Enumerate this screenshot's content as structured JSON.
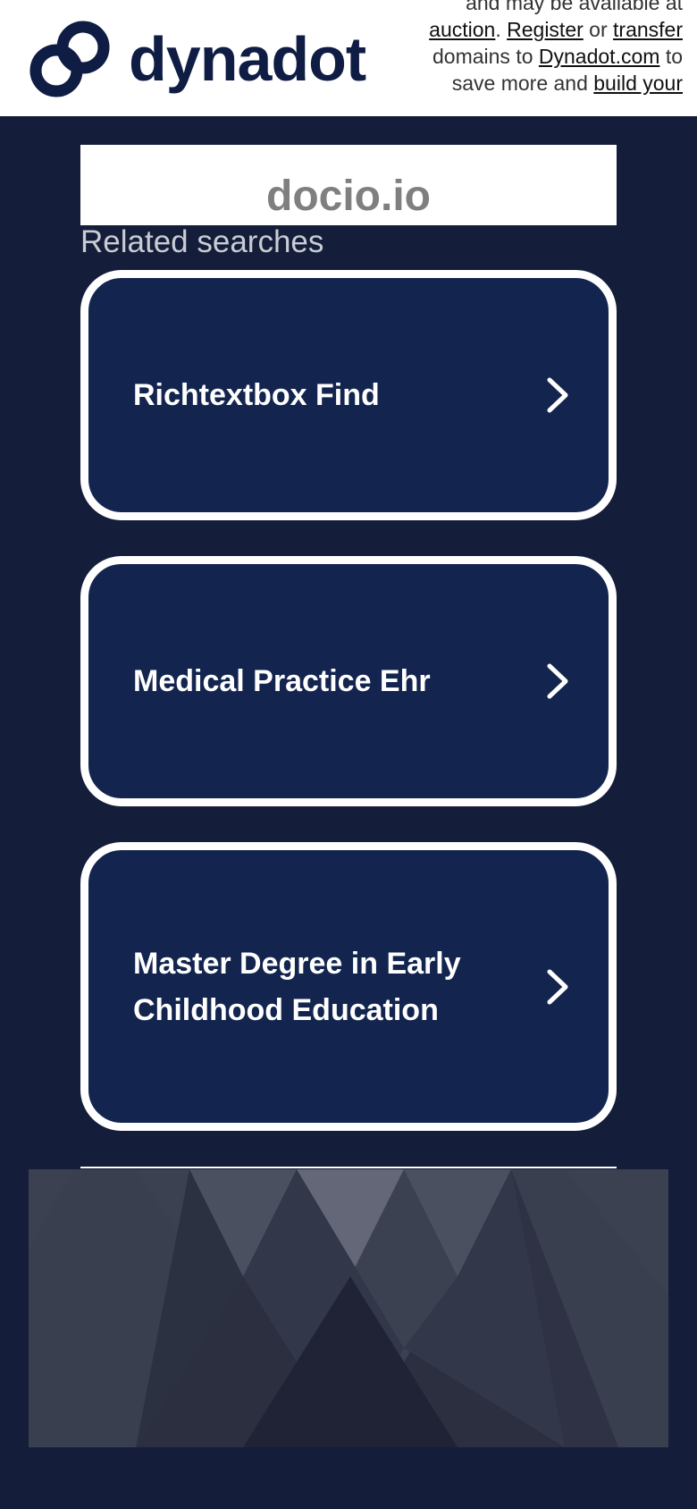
{
  "header": {
    "logo_text": "dynadot",
    "notice": {
      "line1": "and may be available at",
      "auction_link": "auction",
      "after_auction": ".",
      "register_link": "Register",
      "or_text": "or",
      "transfer_link": "transfer",
      "domains_to": "domains to",
      "dynadot_link": "Dynadot.com",
      "to_text": "to",
      "save_more": "save more and",
      "build_link": "build your"
    }
  },
  "domain": {
    "name": "docio.io"
  },
  "related": {
    "title": "Related searches",
    "items": [
      {
        "label": "Richtextbox Find"
      },
      {
        "label": "Medical Practice Ehr"
      },
      {
        "label": "Master Degree in Early Childhood Education"
      }
    ]
  },
  "colors": {
    "page_background": "#141d39",
    "card_background": "#13254f",
    "card_border": "#ffffff",
    "logo_color": "#0f1c44"
  },
  "icons": [
    "dynadot-logo-icon",
    "chevron-right-icon"
  ]
}
